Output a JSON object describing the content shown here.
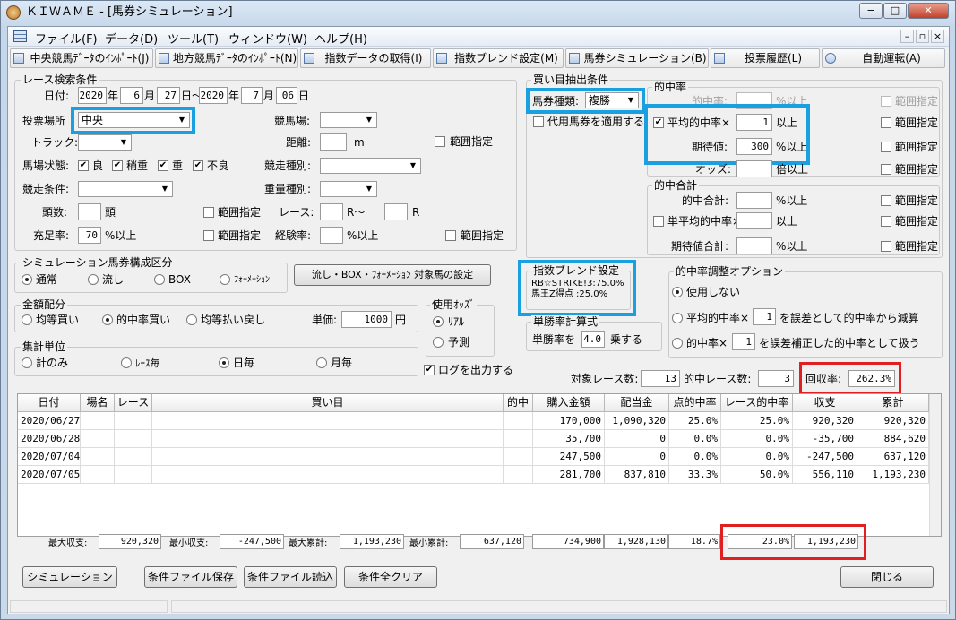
{
  "window": {
    "title": "ＫＩＷＡＭＥ - [馬券シミュレーション]",
    "min": "−",
    "max": "□",
    "close": "✕"
  },
  "menu": [
    "ファイル(F)",
    "データ(D)",
    "ツール(T)",
    "ウィンドウ(W)",
    "ヘルプ(H)"
  ],
  "mdi_controls": [
    "–",
    "▫",
    "×"
  ],
  "toolbar": [
    "中央競馬ﾃﾞｰﾀのｲﾝﾎﾟｰﾄ(J)",
    "地方競馬ﾃﾞｰﾀのｲﾝﾎﾟｰﾄ(N)",
    "指数データの取得(I)",
    "指数ブレンド設定(M)",
    "馬券シミュレーション(B)",
    "投票履歴(L)",
    "自動運転(A)"
  ],
  "race": {
    "group": "レース検索条件",
    "date_label": "日付:",
    "from_year": "2020",
    "year_u": "年",
    "from_month": "6",
    "month_u": "月",
    "from_day": "27",
    "day_tilde": "日～",
    "to_year": "2020",
    "to_month": "7",
    "to_day": "06",
    "day_u": "日",
    "venue_label": "投票場所",
    "venue_value": "中央",
    "course_label": "競馬場:",
    "track_label": "トラック:",
    "distance_label": "距離:",
    "distance_unit": "m",
    "range": "範囲指定",
    "condition_label": "馬場状態:",
    "conditions": [
      "良",
      "稍重",
      "重",
      "不良"
    ],
    "race_type_label": "競走種別:",
    "race_cond_label": "競走条件:",
    "weight_label": "重量種別:",
    "heads_label": "頭数:",
    "heads_unit": "頭",
    "race_label": "レース:",
    "r_tilde": "R～",
    "r_unit": "R",
    "fill_label": "充足率:",
    "fill_value": "70",
    "fill_unit": "%以上",
    "exp_label": "経験率:",
    "exp_unit": "%以上"
  },
  "composition": {
    "group": "シミュレーション馬券構成区分",
    "options": [
      "通常",
      "流し",
      "BOX",
      "ﾌｫｰﾒｰｼｮﾝ"
    ],
    "setting_button": "流し・BOX・ﾌｫｰﾒｰｼｮﾝ 対象馬の設定"
  },
  "alloc": {
    "group": "金額配分",
    "options": [
      "均等買い",
      "的中率買い",
      "均等払い戻し"
    ],
    "unit_label": "単価:",
    "unit_value": "1000",
    "yen": "円"
  },
  "odds": {
    "group": "使用ｵｯｽﾞ",
    "options": [
      "ﾘｱﾙ",
      "予測"
    ]
  },
  "total": {
    "group": "集計単位",
    "options": [
      "計のみ",
      "ﾚｰｽ毎",
      "日毎",
      "月毎"
    ]
  },
  "log_label": "ログを出力する",
  "buy": {
    "group": "買い目抽出条件",
    "type_label": "馬券種類:",
    "type_value": "複勝",
    "proxy_label": "代用馬券を適用する"
  },
  "hit": {
    "group": "的中率",
    "hit_label": "的中率:",
    "pct_up": "%以上",
    "range": "範囲指定",
    "avg_label": "平均的中率×",
    "avg_value": "1",
    "up": "以上",
    "ev_label": "期待値:",
    "ev_value": "300",
    "odds_label": "オッズ:",
    "odds_unit": "倍以上",
    "sum_group": "的中合計",
    "sum_label": "的中合計:",
    "single_label": "単平均的中率×",
    "ev_sum_label": "期待値合計:"
  },
  "blend": {
    "group": "指数ブレンド設定",
    "line1": "RB☆STRIKE!3:75.0%",
    "line2": "馬王Z得点 :25.0%"
  },
  "calc": {
    "group": "単勝率計算式",
    "prefix": "単勝率を",
    "value": "4.0",
    "suffix": "乗する"
  },
  "adjust": {
    "group": "的中率調整オプション",
    "none": "使用しない",
    "opt1_pre": "平均的中率×",
    "opt1_val": "1",
    "opt1_post": "を誤差として的中率から減算",
    "opt2_pre": "的中率×",
    "opt2_val": "1",
    "opt2_post": "を誤差補正した的中率として扱う"
  },
  "stats": {
    "races_label": "対象レース数:",
    "races": "13",
    "hit_races_label": "的中レース数:",
    "hit_races": "3",
    "roi_label": "回収率:",
    "roi": "262.3%"
  },
  "table": {
    "headers": [
      "日付",
      "場名",
      "レース",
      "買い目",
      "的中",
      "購入金額",
      "配当金",
      "点的中率",
      "レース的中率",
      "収支",
      "累計"
    ],
    "rows": [
      [
        "2020/06/27",
        "",
        "",
        "",
        "",
        "170,000",
        "1,090,320",
        "25.0%",
        "25.0%",
        "920,320",
        "920,320"
      ],
      [
        "2020/06/28",
        "",
        "",
        "",
        "",
        "35,700",
        "0",
        "0.0%",
        "0.0%",
        "-35,700",
        "884,620"
      ],
      [
        "2020/07/04",
        "",
        "",
        "",
        "",
        "247,500",
        "0",
        "0.0%",
        "0.0%",
        "-247,500",
        "637,120"
      ],
      [
        "2020/07/05",
        "",
        "",
        "",
        "",
        "281,700",
        "837,810",
        "33.3%",
        "50.0%",
        "556,110",
        "1,193,230"
      ]
    ]
  },
  "summary": {
    "max_label": "最大収支:",
    "max": "920,320",
    "min_label": "最小収支:",
    "min": "-247,500",
    "max_cum_label": "最大累計:",
    "max_cum": "1,193,230",
    "min_cum_label": "最小累計:",
    "min_cum": "637,120",
    "buy": "734,900",
    "pay": "1,928,130",
    "hit": "18.7%",
    "race_hit": "23.0%",
    "balance": "1,193,230"
  },
  "buttons": {
    "sim": "シミュレーション",
    "save": "条件ファイル保存",
    "load": "条件ファイル読込",
    "clear": "条件全クリア",
    "close": "閉じる"
  }
}
